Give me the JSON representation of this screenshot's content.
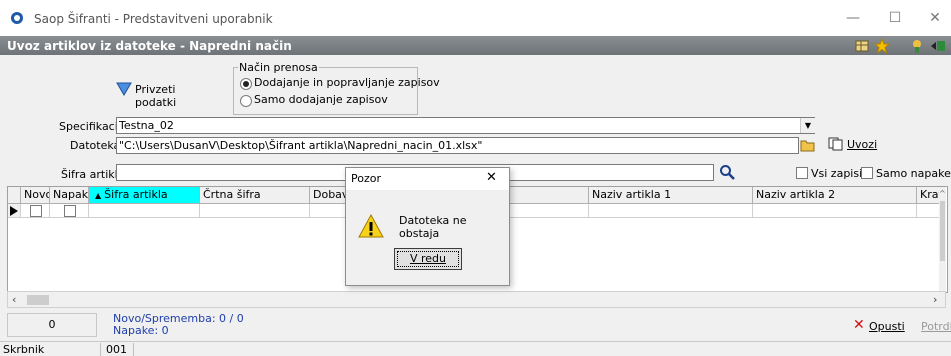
{
  "window": {
    "title": "Saop Šifranti - Predstavitveni uporabnik",
    "minimize": "—",
    "maximize": "☐",
    "close": "✕"
  },
  "form": {
    "title": "Uvoz artiklov iz datoteke - Napredni način",
    "header_icons": [
      "grid-icon",
      "star-icon",
      "tools-icon",
      "exit-icon"
    ]
  },
  "import_button": {
    "label": "Privzeti podatki"
  },
  "transfer_mode": {
    "label": "Način prenosa",
    "options": [
      {
        "label": "Dodajanje in popravljanje zapisov",
        "selected": true
      },
      {
        "label": "Samo dodajanje zapisov",
        "selected": false
      }
    ]
  },
  "specification": {
    "label": "Specifikacija",
    "value": "Testna_02"
  },
  "file": {
    "label": "Datoteka",
    "value": "\"C:\\Users\\DusanV\\Desktop\\Šifrant artikla\\Napredni_nacin_01.xlsx\"",
    "import_label": "Uvozi"
  },
  "filter": {
    "label": "Šifra artikla",
    "value": "",
    "all_records_label": "Vsi zapisi",
    "only_errors_label": "Samo napake"
  },
  "grid": {
    "columns": [
      "Novo",
      "Napake",
      "Šifra artikla",
      "Črtna šifra",
      "Dobavit",
      "Naziv artikla 1",
      "Naziv artikla 2",
      "Krate"
    ]
  },
  "summary": {
    "count": "0",
    "new_change": "Novo/Sprememba: 0 / 0",
    "errors": "Napake: 0"
  },
  "actions": {
    "cancel_label": "Opusti",
    "confirm_label": "Potrdi"
  },
  "statusbar": {
    "user": "Skrbnik",
    "code": "001"
  },
  "dialog": {
    "title": "Pozor",
    "message": "Datoteka ne obstaja",
    "ok_label": "V redu",
    "close": "✕"
  },
  "colors": {
    "header_bar": "#7a7f84",
    "selected_column": "#00ffff",
    "link_blue": "#1f3ea8"
  }
}
